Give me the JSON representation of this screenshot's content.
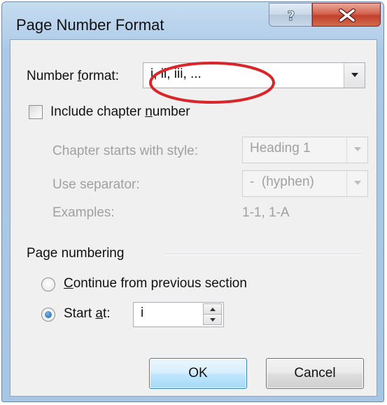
{
  "window": {
    "title": "Page Number Format",
    "help_glyph": "?",
    "close_glyph": "x"
  },
  "number_format": {
    "label_pre": "Number ",
    "label_accel": "f",
    "label_post": "ormat:",
    "value": "i, ii, iii, ..."
  },
  "chapter": {
    "checkbox_pre": "Include chapter ",
    "checkbox_accel": "n",
    "checkbox_post": "umber",
    "checked": false,
    "starts_with_label": "Chapter starts with style:",
    "starts_with_value": "Heading 1",
    "separator_label": "Use separator:",
    "separator_value": "-  (hyphen)",
    "examples_label": "Examples:",
    "examples_value": "1-1, 1-A"
  },
  "page_numbering": {
    "group_label": "Page numbering",
    "continue_accel": "C",
    "continue_rest": "ontinue from previous section",
    "start_pre": "Start ",
    "start_accel": "a",
    "start_post": "t:",
    "start_value": "i",
    "selected": "start_at"
  },
  "buttons": {
    "ok": "OK",
    "cancel": "Cancel"
  },
  "colors": {
    "annotation_circle": "#d8262a",
    "title_bar": "#b8d2ec",
    "close_button": "#c2412b"
  }
}
